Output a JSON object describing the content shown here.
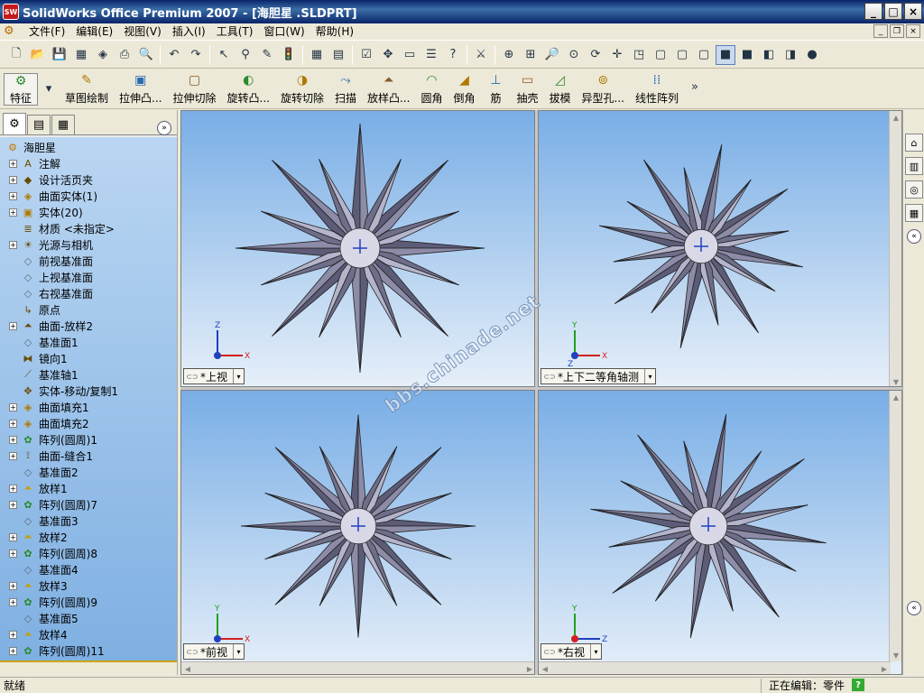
{
  "window": {
    "title": "SolidWorks Office Premium 2007 - [海胆星 .SLDPRT]",
    "app_icon_text": "SW",
    "controls": [
      "_",
      "□",
      "×"
    ]
  },
  "menu": {
    "items": [
      "文件(F)",
      "编辑(E)",
      "视图(V)",
      "插入(I)",
      "工具(T)",
      "窗口(W)",
      "帮助(H)"
    ],
    "right_controls": [
      "_",
      "❐",
      "×"
    ]
  },
  "toolbar1_icons": [
    {
      "name": "new-file-icon",
      "glyph": "🗋"
    },
    {
      "name": "open-icon",
      "glyph": "📂"
    },
    {
      "name": "save-icon",
      "glyph": "💾"
    },
    {
      "name": "make-drawing-icon",
      "glyph": "▦"
    },
    {
      "name": "make-assembly-icon",
      "glyph": "◈"
    },
    {
      "name": "print-icon",
      "glyph": "⎙"
    },
    {
      "name": "print-preview-icon",
      "glyph": "🔍"
    },
    {
      "name": "undo-icon",
      "glyph": "↶"
    },
    {
      "name": "redo-icon",
      "glyph": "↷"
    },
    {
      "name": "select-icon",
      "glyph": "↖"
    },
    {
      "name": "filter-icon",
      "glyph": "⚲"
    },
    {
      "name": "sketch-icon",
      "glyph": "✎"
    },
    {
      "name": "rebuild-icon",
      "glyph": "🚦"
    },
    {
      "name": "grid-icon",
      "glyph": "▦"
    },
    {
      "name": "material-icon",
      "glyph": "▤"
    },
    {
      "name": "options-icon",
      "glyph": "☑"
    },
    {
      "name": "move-icon",
      "glyph": "✥"
    },
    {
      "name": "layout-icon",
      "glyph": "▭"
    },
    {
      "name": "properties-icon",
      "glyph": "☰"
    },
    {
      "name": "help-icon",
      "glyph": "?"
    },
    {
      "name": "measure-icon",
      "glyph": "⚔"
    },
    {
      "name": "zoom-fit-icon",
      "glyph": "⊕"
    },
    {
      "name": "zoom-area-icon",
      "glyph": "⊞"
    },
    {
      "name": "zoom-in-out-icon",
      "glyph": "🔎"
    },
    {
      "name": "zoom-selection-icon",
      "glyph": "⊙"
    },
    {
      "name": "rotate-icon",
      "glyph": "⟳"
    },
    {
      "name": "pan-icon",
      "glyph": "✛"
    },
    {
      "name": "standard-views-icon",
      "glyph": "◳"
    },
    {
      "name": "wireframe-icon",
      "glyph": "▢"
    },
    {
      "name": "hidden-lines-visible-icon",
      "glyph": "▢"
    },
    {
      "name": "hidden-lines-removed-icon",
      "glyph": "▢"
    },
    {
      "name": "shaded-edges-icon",
      "glyph": "■"
    },
    {
      "name": "shaded-icon",
      "glyph": "■"
    },
    {
      "name": "section-view-icon",
      "glyph": "◧"
    },
    {
      "name": "view-orientation-icon",
      "glyph": "◨"
    },
    {
      "name": "realview-icon",
      "glyph": "●"
    }
  ],
  "feature_manager_tabs": {
    "featuremanager": "feature-tree-icon",
    "propertymanager": "property-icon",
    "configurationmanager": "config-icon"
  },
  "toolbar2": {
    "buttons": [
      {
        "label": "特征",
        "icon": "feature-icon",
        "glyph": "⚙",
        "boxed": true
      },
      {
        "label": "草图绘制",
        "icon": "sketch-tab-icon",
        "glyph": "✎",
        "boxed": false
      },
      {
        "label": "拉伸凸...",
        "icon": "extrude-boss-icon",
        "glyph": "▣"
      },
      {
        "label": "拉伸切除",
        "icon": "extrude-cut-icon",
        "glyph": "▢"
      },
      {
        "label": "旋转凸...",
        "icon": "revolve-boss-icon",
        "glyph": "◐"
      },
      {
        "label": "旋转切除",
        "icon": "revolve-cut-icon",
        "glyph": "◑"
      },
      {
        "label": "扫描",
        "icon": "sweep-icon",
        "glyph": "⤳"
      },
      {
        "label": "放样凸...",
        "icon": "loft-icon",
        "glyph": "⏶"
      },
      {
        "label": "圆角",
        "icon": "fillet-icon",
        "glyph": "◠"
      },
      {
        "label": "倒角",
        "icon": "chamfer-icon",
        "glyph": "◢"
      },
      {
        "label": "筋",
        "icon": "rib-icon",
        "glyph": "⊥"
      },
      {
        "label": "抽壳",
        "icon": "shell-icon",
        "glyph": "▭"
      },
      {
        "label": "拔模",
        "icon": "draft-icon",
        "glyph": "◿"
      },
      {
        "label": "异型孔...",
        "icon": "hole-wizard-icon",
        "glyph": "⊚"
      },
      {
        "label": "线性阵列",
        "icon": "linear-pattern-icon",
        "glyph": "⁞⁞"
      }
    ],
    "more": "»"
  },
  "feature_tree": {
    "root": "海胆星",
    "nodes": [
      {
        "label": "注解",
        "icon": "annotations-icon",
        "expand": "+",
        "glyph": "A"
      },
      {
        "label": "设计活页夹",
        "icon": "design-binder-icon",
        "expand": "+",
        "glyph": "◆"
      },
      {
        "label": "曲面实体(1)",
        "icon": "surface-bodies-icon",
        "expand": "+",
        "glyph": "◈"
      },
      {
        "label": "实体(20)",
        "icon": "solid-bodies-icon",
        "expand": "+",
        "glyph": "▣"
      },
      {
        "label": "材质 <未指定>",
        "icon": "material-tree-icon",
        "expand": "",
        "glyph": "≣"
      },
      {
        "label": "光源与相机",
        "icon": "lights-cameras-icon",
        "expand": "+",
        "glyph": "☀"
      },
      {
        "label": "前视基准面",
        "icon": "plane-icon",
        "expand": "",
        "glyph": "◇"
      },
      {
        "label": "上视基准面",
        "icon": "plane-icon",
        "expand": "",
        "glyph": "◇"
      },
      {
        "label": "右视基准面",
        "icon": "plane-icon",
        "expand": "",
        "glyph": "◇"
      },
      {
        "label": "原点",
        "icon": "origin-icon",
        "expand": "",
        "glyph": "↳"
      },
      {
        "label": "曲面-放样2",
        "icon": "surface-loft-icon",
        "expand": "+",
        "glyph": "⏶"
      },
      {
        "label": "基准面1",
        "icon": "plane-icon",
        "expand": "",
        "glyph": "◇"
      },
      {
        "label": "镜向1",
        "icon": "mirror-icon",
        "expand": "",
        "glyph": "⧓"
      },
      {
        "label": "基准轴1",
        "icon": "axis-icon",
        "expand": "",
        "glyph": "⟋"
      },
      {
        "label": "实体-移动/复制1",
        "icon": "move-copy-icon",
        "expand": "",
        "glyph": "✥"
      },
      {
        "label": "曲面填充1",
        "icon": "surface-fill-icon",
        "expand": "+",
        "glyph": "◈"
      },
      {
        "label": "曲面填充2",
        "icon": "surface-fill-icon",
        "expand": "+",
        "glyph": "◈"
      },
      {
        "label": "阵列(圆周)1",
        "icon": "circular-pattern-icon",
        "expand": "+",
        "glyph": "✿"
      },
      {
        "label": "曲面-缝合1",
        "icon": "knit-icon",
        "expand": "+",
        "glyph": "⟟"
      },
      {
        "label": "基准面2",
        "icon": "plane-icon",
        "expand": "",
        "glyph": "◇"
      },
      {
        "label": "放样1",
        "icon": "loft-tree-icon",
        "expand": "+",
        "glyph": "⏶"
      },
      {
        "label": "阵列(圆周)7",
        "icon": "circular-pattern-icon",
        "expand": "+",
        "glyph": "✿"
      },
      {
        "label": "基准面3",
        "icon": "plane-icon",
        "expand": "",
        "glyph": "◇"
      },
      {
        "label": "放样2",
        "icon": "loft-tree-icon",
        "expand": "+",
        "glyph": "⏶"
      },
      {
        "label": "阵列(圆周)8",
        "icon": "circular-pattern-icon",
        "expand": "+",
        "glyph": "✿"
      },
      {
        "label": "基准面4",
        "icon": "plane-icon",
        "expand": "",
        "glyph": "◇"
      },
      {
        "label": "放样3",
        "icon": "loft-tree-icon",
        "expand": "+",
        "glyph": "⏶"
      },
      {
        "label": "阵列(圆周)9",
        "icon": "circular-pattern-icon",
        "expand": "+",
        "glyph": "✿"
      },
      {
        "label": "基准面5",
        "icon": "plane-icon",
        "expand": "",
        "glyph": "◇"
      },
      {
        "label": "放样4",
        "icon": "loft-tree-icon",
        "expand": "+",
        "glyph": "⏶"
      },
      {
        "label": "阵列(圆周)11",
        "icon": "circular-pattern-icon",
        "expand": "+",
        "glyph": "✿"
      }
    ]
  },
  "viewports": [
    {
      "label": "*上视",
      "triad": {
        "v": "Z",
        "h": "X"
      }
    },
    {
      "label": "*上下二等角轴测",
      "triad": {
        "v": "Y",
        "h": "X",
        "d": "Z"
      }
    },
    {
      "label": "*前视",
      "triad": {
        "v": "Y",
        "h": "X"
      }
    },
    {
      "label": "*右视",
      "triad": {
        "v": "Y",
        "h": "Z"
      }
    }
  ],
  "watermark": "bbs.chinade.net",
  "task_pane_icons": [
    "home-icon",
    "design-library-icon",
    "file-explorer-icon",
    "view-palette-icon"
  ],
  "status": {
    "left": "就绪",
    "right": "正在编辑：零件",
    "help": "?"
  },
  "colors": {
    "title_bar": "#0a246a",
    "tree_bg": "#9cc4ec",
    "viewport_top": "#79aee6",
    "viewport_bottom": "#e6eff9",
    "axis_x": "#d42020",
    "axis_y": "#20a020",
    "axis_z": "#2040c0"
  }
}
